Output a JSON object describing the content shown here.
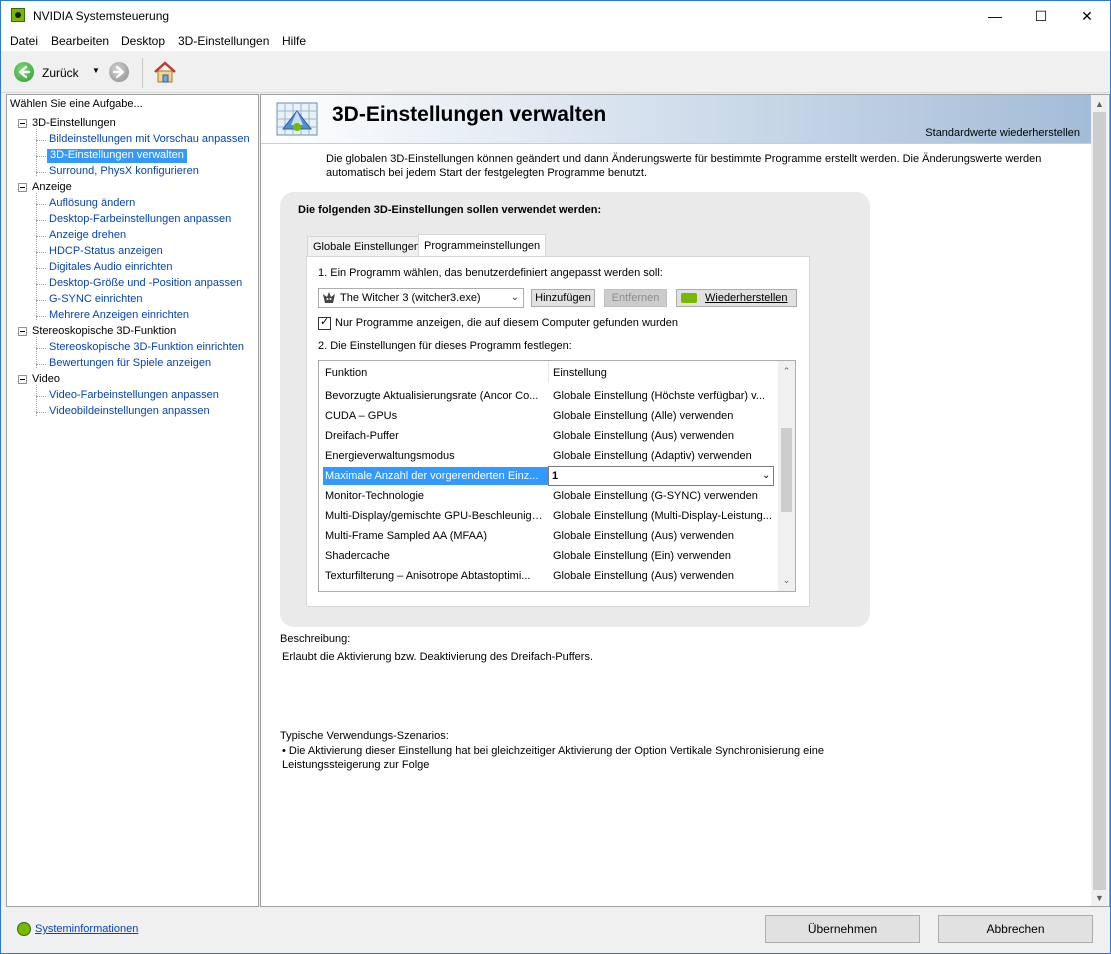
{
  "window": {
    "title": "NVIDIA Systemsteuerung",
    "controls": {
      "minimize": "—",
      "maximize": "☐",
      "close": "✕"
    }
  },
  "menu": [
    "Datei",
    "Bearbeiten",
    "Desktop",
    "3D-Einstellungen",
    "Hilfe"
  ],
  "toolbar": {
    "back_label": "Zurück",
    "back_dropdown": "▼"
  },
  "sidebar": {
    "header": "Wählen Sie eine Aufgabe...",
    "groups": [
      {
        "label": "3D-Einstellungen",
        "items": [
          "Bildeinstellungen mit Vorschau anpassen",
          "3D-Einstellungen verwalten",
          "Surround, PhysX konfigurieren"
        ]
      },
      {
        "label": "Anzeige",
        "items": [
          "Auflösung ändern",
          "Desktop-Farbeinstellungen anpassen",
          "Anzeige drehen",
          "HDCP-Status anzeigen",
          "Digitales Audio einrichten",
          "Desktop-Größe und -Position anpassen",
          "G-SYNC einrichten",
          "Mehrere Anzeigen einrichten"
        ]
      },
      {
        "label": "Stereoskopische 3D-Funktion",
        "items": [
          "Stereoskopische 3D-Funktion einrichten",
          "Bewertungen für Spiele anzeigen"
        ]
      },
      {
        "label": "Video",
        "items": [
          "Video-Farbeinstellungen anpassen",
          "Videobildeinstellungen anpassen"
        ]
      }
    ],
    "selected_item": "3D-Einstellungen verwalten"
  },
  "content": {
    "title": "3D-Einstellungen verwalten",
    "restore_defaults": "Standardwerte wiederherstellen",
    "intro": "Die globalen 3D-Einstellungen können geändert und dann Änderungswerte für bestimmte Programme erstellt werden. Die Änderungswerte werden automatisch bei jedem Start der festgelegten Programme benutzt.",
    "panel_title": "Die folgenden 3D-Einstellungen sollen verwendet werden:",
    "tabs": [
      {
        "label": "Globale Einstellungen",
        "active": false
      },
      {
        "label": "Programmeinstellungen",
        "active": true
      }
    ],
    "step1": "1. Ein Programm wählen, das benutzerdefiniert angepasst werden soll:",
    "program": "The Witcher 3 (witcher3.exe)",
    "buttons": {
      "add": "Hinzufügen",
      "remove": "Entfernen",
      "restore": "Wiederherstellen"
    },
    "checkbox": {
      "label": "Nur Programme anzeigen, die auf diesem Computer gefunden wurden",
      "checked": true,
      "mark": "✓"
    },
    "step2": "2. Die Einstellungen für dieses Programm festlegen:",
    "table": {
      "headers": [
        "Funktion",
        "Einstellung"
      ],
      "rows": [
        {
          "function": "Bevorzugte Aktualisierungsrate (Ancor Co...",
          "setting": "Globale Einstellung (Höchste verfügbar) v..."
        },
        {
          "function": "CUDA – GPUs",
          "setting": "Globale Einstellung (Alle) verwenden"
        },
        {
          "function": "Dreifach-Puffer",
          "setting": "Globale Einstellung (Aus) verwenden"
        },
        {
          "function": "Energieverwaltungsmodus",
          "setting": "Globale Einstellung (Adaptiv) verwenden"
        },
        {
          "function": "Maximale Anzahl der vorgerenderten Einz...",
          "setting": "1",
          "selected": true
        },
        {
          "function": "Monitor-Technologie",
          "setting": "Globale Einstellung (G-SYNC) verwenden"
        },
        {
          "function": "Multi-Display/gemischte GPU-Beschleunigung",
          "setting": "Globale Einstellung (Multi-Display-Leistung..."
        },
        {
          "function": "Multi-Frame Sampled AA (MFAA)",
          "setting": "Globale Einstellung (Aus) verwenden"
        },
        {
          "function": "Shadercache",
          "setting": "Globale Einstellung (Ein) verwenden"
        },
        {
          "function": "Texturfilterung – Anisotrope Abtastoptimi...",
          "setting": "Globale Einstellung (Aus) verwenden"
        }
      ]
    },
    "description_label": "Beschreibung:",
    "description": "Erlaubt die Aktivierung bzw. Deaktivierung des Dreifach-Puffers.",
    "usage_label": "Typische Verwendungs-Szenarios:",
    "usage": "• Die Aktivierung dieser Einstellung hat bei gleichzeitiger Aktivierung der Option Vertikale Synchronisierung eine Leistungssteigerung zur Folge"
  },
  "footer": {
    "system_info": "Systeminformationen",
    "apply": "Übernehmen",
    "cancel": "Abbrechen"
  },
  "colors": {
    "nvidia_green": "#76b900",
    "selection_blue": "#3399ff",
    "link_blue": "#0645ad"
  }
}
